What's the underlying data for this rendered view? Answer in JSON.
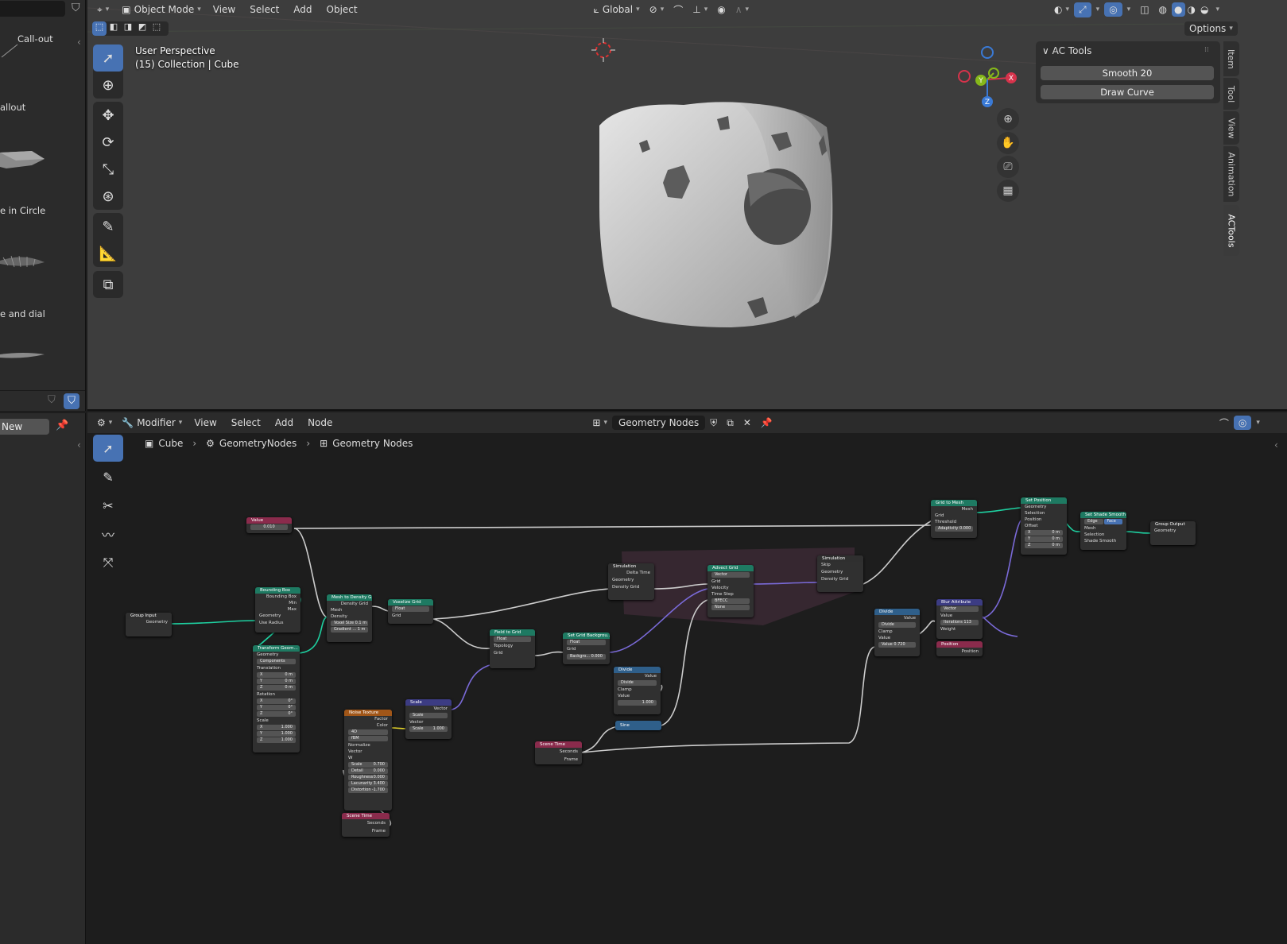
{
  "left_panel": {
    "assets": [
      "Call-out",
      "allout",
      "e in Circle",
      "e and dial"
    ],
    "new_button": "New"
  },
  "viewport": {
    "header": {
      "mode": "Object Mode",
      "menus": [
        "View",
        "Select",
        "Add",
        "Object"
      ],
      "transform_orientation": "Global",
      "options": "Options"
    },
    "overlay": {
      "perspective": "User Perspective",
      "collection": "(15) Collection | Cube"
    },
    "axes": {
      "x": "X",
      "y": "Y",
      "z": "Z"
    },
    "ac_tools": {
      "title": "AC Tools",
      "buttons": [
        "Smooth 20",
        "Draw Curve"
      ]
    },
    "side_tabs": [
      "Item",
      "Tool",
      "View",
      "Animation",
      "ACTools"
    ],
    "colors": {
      "x_axis": "#d6334b",
      "y_axis": "#86b81a",
      "z_axis": "#3a7ad6",
      "active": "#4772b3"
    }
  },
  "node_editor": {
    "header": {
      "editor": "Modifier",
      "menus": [
        "View",
        "Select",
        "Add",
        "Node"
      ],
      "node_group": "Geometry Nodes"
    },
    "breadcrumb": [
      "Cube",
      "GeometryNodes",
      "Geometry Nodes"
    ],
    "nodes": {
      "value": {
        "title": "Value",
        "value": "0.010"
      },
      "group_input": {
        "title": "Group Input",
        "out": "Geometry"
      },
      "bounding_box": {
        "title": "Bounding Box",
        "rows": [
          "Bounding Box",
          "Min",
          "Max",
          "Geometry",
          "Use Radius"
        ]
      },
      "transform": {
        "title": "Transform Geom...",
        "rows": [
          "Geometry",
          "Components",
          "Translation",
          "X",
          "0 m",
          "Y",
          "0 m",
          "Z",
          "0 m",
          "Rotation",
          "X",
          "0°",
          "Y",
          "0°",
          "Z",
          "0°",
          "Scale",
          "X",
          "1.000",
          "Y",
          "1.000",
          "Z",
          "1.000"
        ]
      },
      "mesh_to_density": {
        "title": "Mesh to Density G...",
        "rows": [
          "Density Grid",
          "Mesh",
          "Density",
          "Voxel Size",
          "0.1 m",
          "Gradient ...",
          "1 m"
        ]
      },
      "voxelize": {
        "title": "Voxelize Grid",
        "rows": [
          "Float",
          "Grid"
        ]
      },
      "field_to_grid": {
        "title": "Field to Grid",
        "rows": [
          "Float",
          "Topology",
          "Grid"
        ]
      },
      "set_background": {
        "title": "Set Grid Backgrou...",
        "rows": [
          "Float",
          "Grid",
          "Backgro...",
          "0.000"
        ]
      },
      "sim_in": {
        "title": "Simulation",
        "rows": [
          "Delta Time",
          "Geometry",
          "Density Grid"
        ]
      },
      "advect": {
        "title": "Advect Grid",
        "rows": [
          "Vector",
          "Grid",
          "Velocity",
          "Time Step",
          "BFECC",
          "None"
        ]
      },
      "sim_out": {
        "title": "Simulation",
        "rows": [
          "Skip",
          "Geometry",
          "Density Grid"
        ]
      },
      "grid_to_mesh": {
        "title": "Grid to Mesh",
        "rows": [
          "Mesh",
          "Grid",
          "Threshold",
          "Adaptivity",
          "0.000"
        ]
      },
      "set_position": {
        "title": "Set Position",
        "rows": [
          "Geometry",
          "Selection",
          "Position",
          "Offset",
          "X",
          "0 m",
          "Y",
          "0 m",
          "Z",
          "0 m"
        ]
      },
      "set_shade": {
        "title": "Set Shade Smooth",
        "rows": [
          "Edge",
          "Face",
          "Mesh",
          "Selection",
          "Shade Smooth"
        ]
      },
      "group_output": {
        "title": "Group Output",
        "rows": [
          "Geometry"
        ]
      },
      "divide_a": {
        "title": "Divide",
        "rows": [
          "Value",
          "Divide",
          "Clamp",
          "Value",
          "1.000"
        ]
      },
      "sine": {
        "title": "Sine"
      },
      "divide_b": {
        "title": "Divide",
        "rows": [
          "Value",
          "Divide",
          "Clamp",
          "Value",
          "Value",
          "0.720"
        ]
      },
      "blur": {
        "title": "Blur Attribute",
        "rows": [
          "Vector",
          "Value",
          "Iterations",
          "113",
          "Weight"
        ]
      },
      "position": {
        "title": "Position",
        "rows": [
          "Position"
        ]
      },
      "scene_time_a": {
        "title": "Scene Time",
        "rows": [
          "Seconds",
          "Frame"
        ]
      },
      "noise": {
        "title": "Noise Texture",
        "rows": [
          "Factor",
          "Color",
          "4D",
          "fBM",
          "Normalize",
          "Vector",
          "W",
          "Scale",
          "0.700",
          "Detail",
          "0.000",
          "Roughness",
          "0.000",
          "Lacunarity",
          "3.400",
          "Distortion",
          "-1.700"
        ]
      },
      "scale": {
        "title": "Scale",
        "rows": [
          "Vector",
          "Scale",
          "Vector",
          "Scale",
          "1.000"
        ]
      },
      "scene_time_b": {
        "title": "Scene Time",
        "rows": [
          "Seconds",
          "Frame"
        ]
      }
    }
  }
}
